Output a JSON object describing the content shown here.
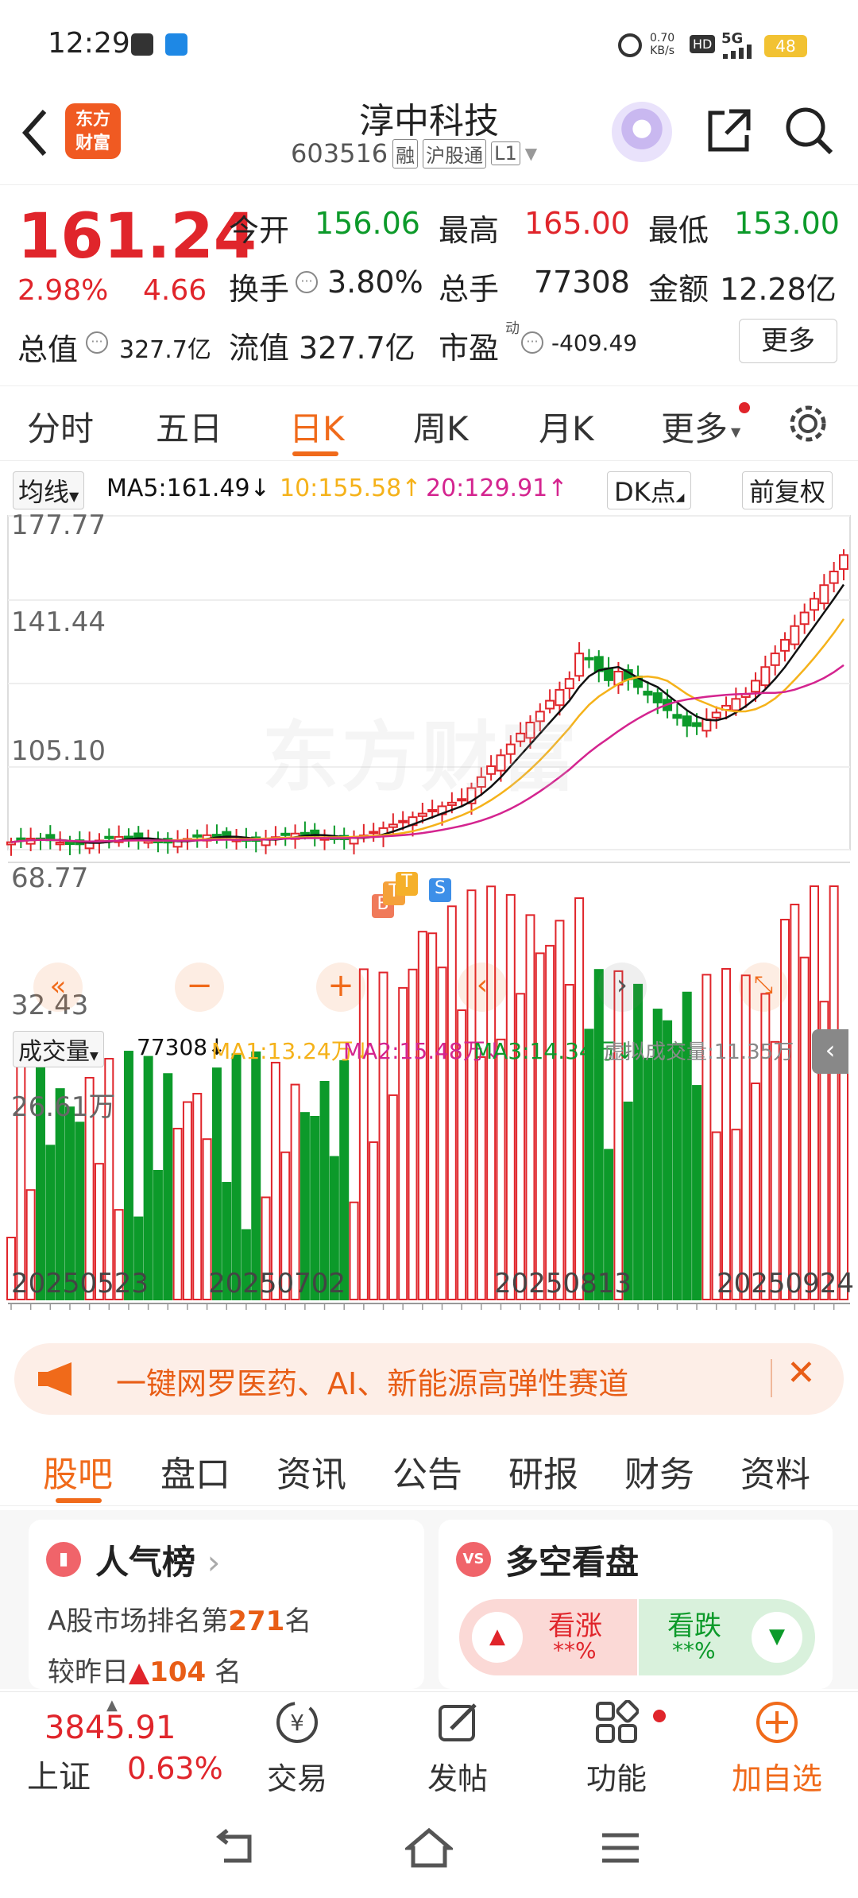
{
  "status": {
    "time": "12:29",
    "speed_top": "0.70",
    "speed_bottom": "KB/s",
    "hd": "HD",
    "net": "5G",
    "battery": "48"
  },
  "header": {
    "logo_line1": "东方",
    "logo_line2": "财富",
    "title": "淳中科技",
    "code": "603516",
    "tags": [
      "融",
      "沪股通",
      "L1"
    ]
  },
  "quote": {
    "price": "161.24",
    "pct": "2.98%",
    "chg": "4.66",
    "open_label": "今开",
    "open": "156.06",
    "high_label": "最高",
    "high": "165.00",
    "low_label": "最低",
    "low": "153.00",
    "turnover_label": "换手",
    "turnover": "3.80%",
    "vol_label": "总手",
    "vol": "77308",
    "amount_label": "金额",
    "amount": "12.28亿",
    "mcap_label": "总值",
    "mcap": "327.7亿",
    "float_label": "流值",
    "float": "327.7亿",
    "pe_label": "市盈",
    "pe_sup": "动",
    "pe": "-409.49",
    "more": "更多"
  },
  "tabs": [
    "分时",
    "五日",
    "日K",
    "周K",
    "月K",
    "更多"
  ],
  "ma_bar": {
    "selector": "均线",
    "ma5": "MA5:161.49",
    "ma10": "10:155.58",
    "ma20": "20:129.91",
    "dk": "DK点",
    "fq": "前复权"
  },
  "price_axis": [
    "177.77",
    "141.44",
    "105.10",
    "68.77",
    "32.43"
  ],
  "watermark": "东方财富",
  "signals": [
    "B",
    "T",
    "T",
    "S"
  ],
  "vol_bar": {
    "selector": "成交量",
    "vol": "77308",
    "ma1": "MA1:13.24万",
    "ma2": "MA2:15.48万",
    "ma3": "MA3:14.34万",
    "virtual": "虚拟成交量:11.35万"
  },
  "vol_axis": "26.61万",
  "dates": [
    "20250523",
    "20250702",
    "20250813",
    "20250924"
  ],
  "banner": {
    "text": "一键网罗医药、AI、新能源高弹性赛道"
  },
  "subtabs": [
    "股吧",
    "盘口",
    "资讯",
    "公告",
    "研报",
    "财务",
    "资料"
  ],
  "rank": {
    "title": "人气榜",
    "line1_pre": "A股市场排名第",
    "rank": "271",
    "line1_post": "名",
    "line2_pre": "较昨日",
    "delta": "104",
    "line2_post": "名"
  },
  "duokong": {
    "title": "多空看盘",
    "up": "看涨",
    "up_val": "**%",
    "down": "看跌",
    "down_val": "**%"
  },
  "index": {
    "value": "3845.91",
    "name": "上证",
    "pct": "0.63%"
  },
  "bottom": {
    "trade": "交易",
    "post": "发帖",
    "func": "功能",
    "add": "加自选"
  },
  "colors": {
    "up": "#e0252b",
    "down": "#0c9a2a",
    "accent": "#f06a1a",
    "ma5": "#111111",
    "ma10": "#f5b21a",
    "ma20": "#d4248f"
  },
  "chart_data": {
    "type": "candlestick",
    "ylim": [
      32.43,
      177.77
    ],
    "x": [
      "20250523",
      "20250702",
      "20250813",
      "20250924"
    ],
    "last_close": 161.24,
    "ma5_last": 161.49,
    "ma10_last": 155.58,
    "ma20_last": 129.91,
    "volume_max": "26.61万"
  }
}
